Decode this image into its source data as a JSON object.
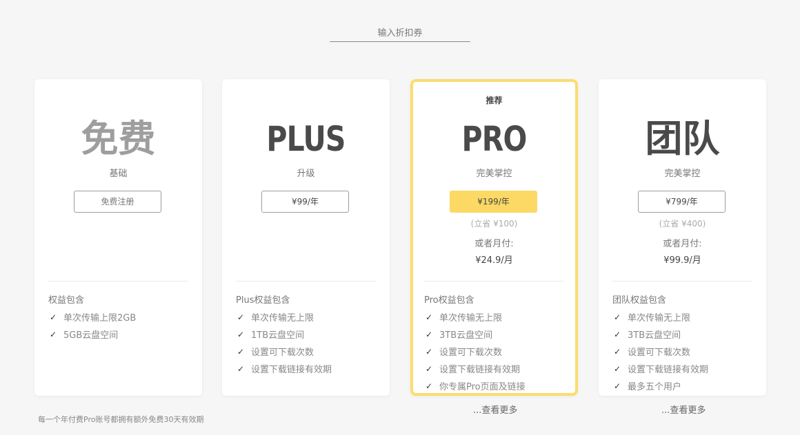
{
  "coupon": {
    "placeholder": "输入折扣券"
  },
  "plans": {
    "free": {
      "name": "免费",
      "subtitle": "基础",
      "button": "免费注册",
      "features_title": "权益包含",
      "features": [
        "单次传输上限2GB",
        "5GB云盘空间"
      ]
    },
    "plus": {
      "name": "PLUS",
      "subtitle": "升级",
      "button": "¥99/年",
      "features_title": "Plus权益包含",
      "features": [
        "单次传输无上限",
        "1TB云盘空间",
        "设置可下载次数",
        "设置下载链接有效期"
      ]
    },
    "pro": {
      "badge": "推荐",
      "name": "PRO",
      "subtitle": "完美掌控",
      "button": "¥199/年",
      "savings": "(立省 ¥100)",
      "monthly_label": "或者月付:",
      "monthly_price": "¥24.9/月",
      "features_title": "Pro权益包含",
      "features": [
        "单次传输无上限",
        "3TB云盘空间",
        "设置可下载次数",
        "设置下载链接有效期",
        "你专属Pro页面及链接"
      ],
      "more": "...查看更多"
    },
    "team": {
      "name": "团队",
      "subtitle": "完美掌控",
      "button": "¥799/年",
      "savings": "(立省 ¥400)",
      "monthly_label": "或者月付:",
      "monthly_price": "¥99.9/月",
      "features_title": "团队权益包含",
      "features": [
        "单次传输无上限",
        "3TB云盘空间",
        "设置可下载次数",
        "设置下载链接有效期",
        "最多五个用户"
      ],
      "more": "...查看更多"
    }
  },
  "footnote": "每一个年付费Pro账号都拥有额外免费30天有效期",
  "colors": {
    "accent": "#fbd964",
    "featured_border": "#fbdd6e"
  },
  "icons": {
    "feature_bullet": "check-icon"
  }
}
